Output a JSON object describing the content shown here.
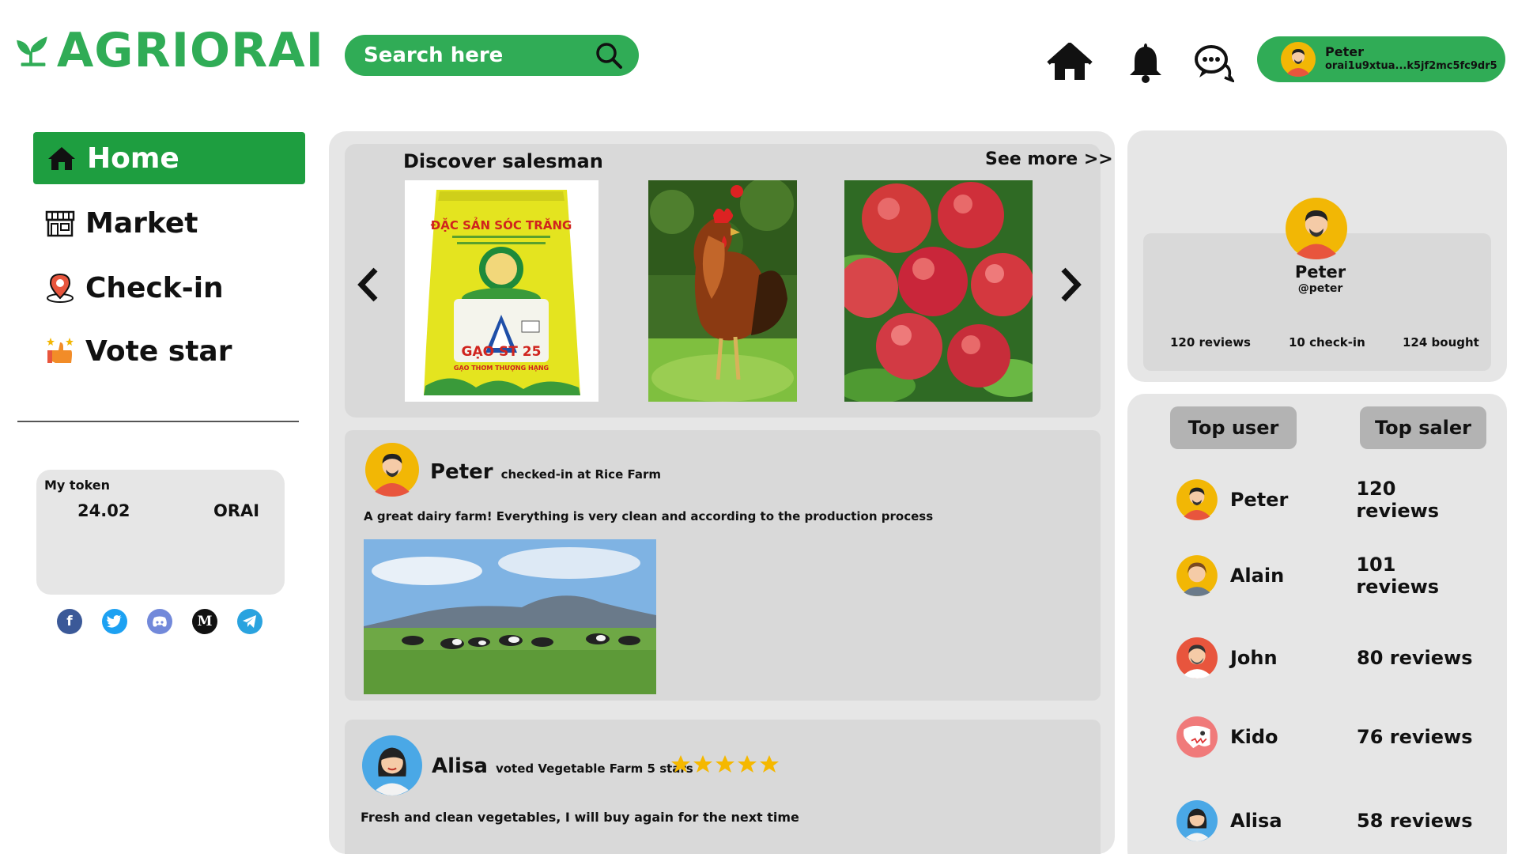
{
  "brand": {
    "name": "AGRIORAI",
    "color": "#30ac56"
  },
  "header": {
    "search_placeholder": "Search here",
    "icons": [
      "home-icon",
      "bell-icon",
      "chat-icon"
    ],
    "user": {
      "name": "Peter",
      "address": "orai1u9xtua...k5jf2mc5fc9dr5"
    }
  },
  "sidebar": {
    "items": [
      {
        "label": "Home",
        "icon": "home-icon",
        "active": true
      },
      {
        "label": "Market",
        "icon": "store-icon",
        "active": false
      },
      {
        "label": "Check-in",
        "icon": "location-pin-icon",
        "active": false
      },
      {
        "label": "Vote star",
        "icon": "thumbs-up-stars-icon",
        "active": false
      }
    ],
    "token": {
      "label": "My token",
      "value": "24.02",
      "unit": "ORAI"
    },
    "socials": [
      "facebook-icon",
      "twitter-icon",
      "discord-icon",
      "medium-icon",
      "telegram-icon"
    ]
  },
  "discover": {
    "title": "Discover salesman",
    "see_more": "See more >>",
    "products": [
      {
        "name": "rice-bag-image",
        "bag_title": "ĐẶC SẢN SÓC TRĂNG",
        "bag_label": "GẠO ST 25",
        "bag_sub": "GẠO THƠM THƯỢNG HẠNG"
      },
      {
        "name": "rooster-image"
      },
      {
        "name": "apples-image"
      }
    ]
  },
  "posts": [
    {
      "user": "Peter",
      "action": "checked-in at Rice Farm",
      "body": "A great dairy farm! Everything is very clean and according to the production process",
      "image": "dairy-farm-image"
    },
    {
      "user": "Alisa",
      "action": "voted Vegetable Farm 5 stars",
      "stars": 5,
      "body": "Fresh and clean vegetables, I will buy again for the next time"
    }
  ],
  "profile": {
    "name": "Peter",
    "handle": "@peter",
    "stats": [
      "120 reviews",
      "10 check-in",
      "124 bought"
    ]
  },
  "rankings": {
    "tabs": [
      "Top user",
      "Top saler"
    ],
    "rows": [
      {
        "name": "Peter",
        "value": "120 reviews",
        "avatar_bg": "#f2b705"
      },
      {
        "name": "Alain",
        "value": "101 reviews",
        "avatar_bg": "#f2b705"
      },
      {
        "name": "John",
        "value": "80 reviews",
        "avatar_bg": "#e8553d"
      },
      {
        "name": "Kido",
        "value": "76 reviews",
        "avatar_bg": "#f07a7a"
      },
      {
        "name": "Alisa",
        "value": "58 reviews",
        "avatar_bg": "#4aa8e6"
      }
    ]
  }
}
